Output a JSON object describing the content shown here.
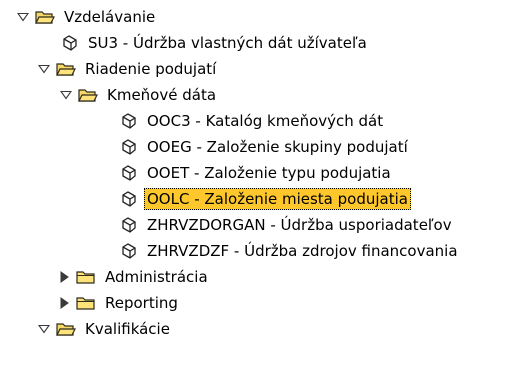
{
  "colors": {
    "selected_bg": "#fec82c",
    "folder_fill": "#fde37a",
    "folder_stroke": "#2e2a1c"
  },
  "tree": {
    "n0": {
      "label": "Vzdelávanie"
    },
    "n1": {
      "label": "SU3 - Údržba vlastných dát užívateľa"
    },
    "n2": {
      "label": "Riadenie podujatí"
    },
    "n3": {
      "label": "Kmeňové dáta"
    },
    "n4": {
      "label": "OOC3 - Katalóg kmeňových dát"
    },
    "n5": {
      "label": "OOEG - Založenie skupiny podujatí"
    },
    "n6": {
      "label": "OOET - Založenie typu podujatia"
    },
    "n7": {
      "label": "OOLC - Založenie miesta podujatia"
    },
    "n8": {
      "label": "ZHRVZDORGAN - Údržba usporiadateľov"
    },
    "n9": {
      "label": "ZHRVZDZF - Údržba zdrojov financovania"
    },
    "n10": {
      "label": "Administrácia"
    },
    "n11": {
      "label": "Reporting"
    },
    "n12": {
      "label": "Kvalifikácie"
    }
  }
}
